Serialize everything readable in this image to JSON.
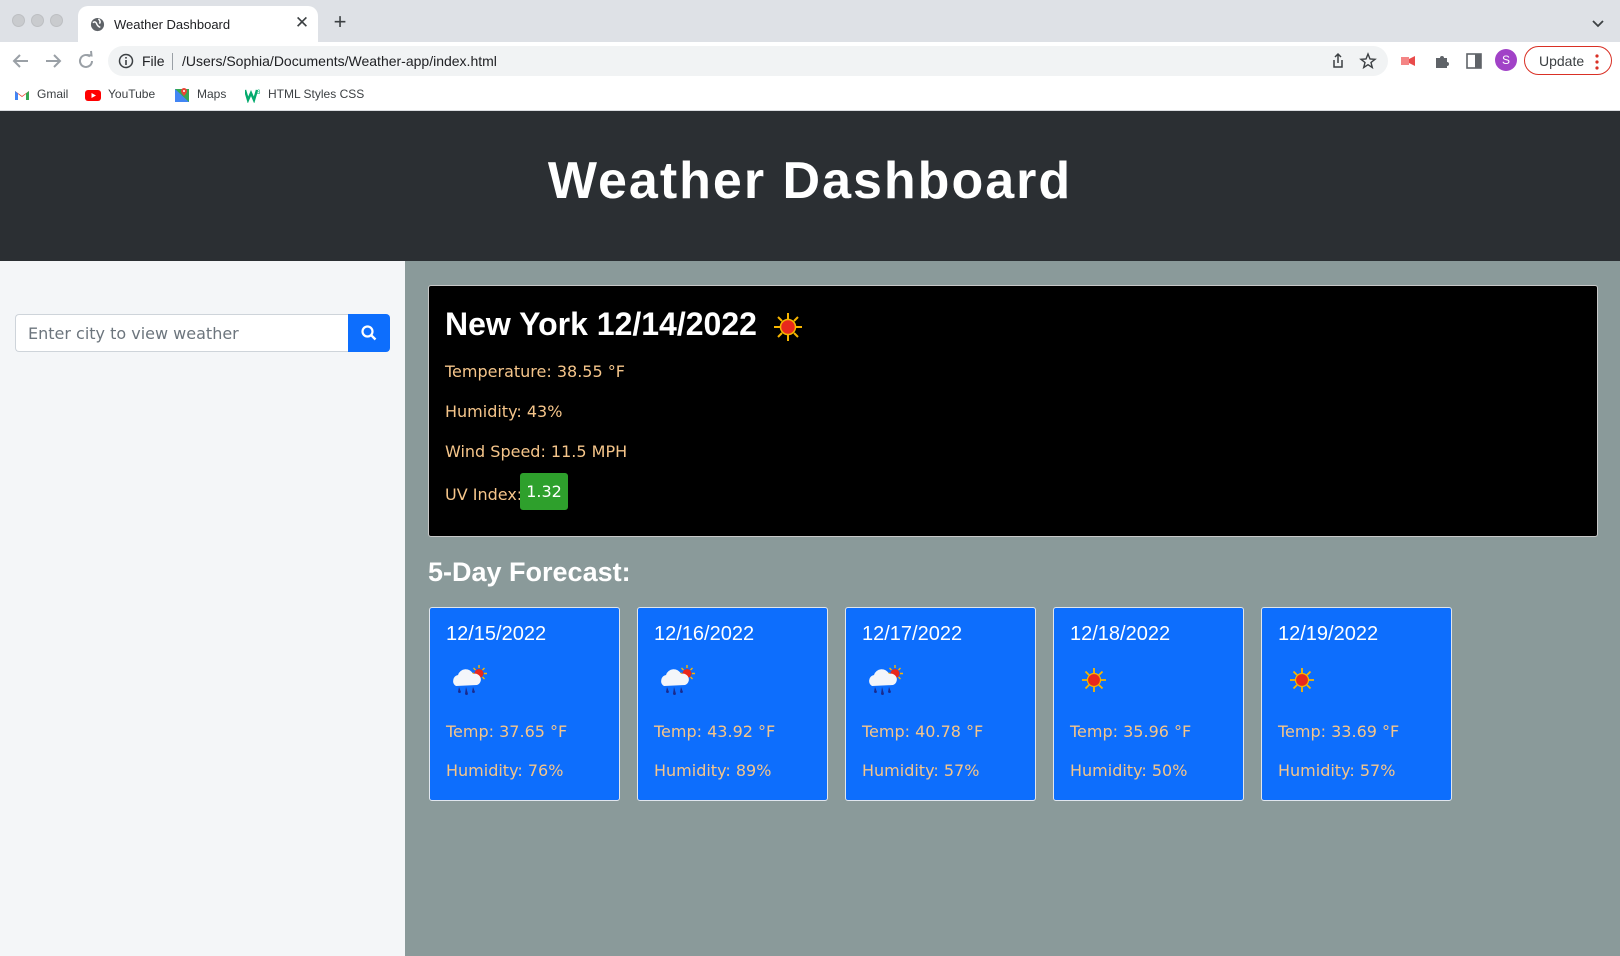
{
  "browser": {
    "tab_title": "Weather Dashboard",
    "omnibox_scheme": "File",
    "url": "/Users/Sophia/Documents/Weather-app/index.html",
    "profile_initial": "S",
    "update_label": "Update",
    "bookmarks": [
      {
        "label": "Gmail",
        "icon": "gmail-icon"
      },
      {
        "label": "YouTube",
        "icon": "youtube-icon"
      },
      {
        "label": "Maps",
        "icon": "maps-icon"
      },
      {
        "label": "HTML Styles CSS",
        "icon": "w3schools-icon"
      }
    ]
  },
  "header": {
    "title": "Weather Dashboard"
  },
  "search": {
    "placeholder": "Enter city to view weather",
    "button_icon": "search-icon"
  },
  "current": {
    "title": "New York 12/14/2022",
    "icon": "sun-icon",
    "temperature": "Temperature: 38.55 °F",
    "humidity": "Humidity: 43%",
    "wind": "Wind Speed: 11.5 MPH",
    "uv_label": "UV Index:",
    "uv_value": "1.32"
  },
  "forecast": {
    "title": "5-Day Forecast:",
    "days": [
      {
        "date": "12/15/2022",
        "icon": "rain-cloud-sun-icon",
        "temp": "Temp: 37.65 °F",
        "humidity": "Humidity: 76%"
      },
      {
        "date": "12/16/2022",
        "icon": "rain-cloud-sun-icon",
        "temp": "Temp: 43.92 °F",
        "humidity": "Humidity: 89%"
      },
      {
        "date": "12/17/2022",
        "icon": "rain-cloud-sun-icon",
        "temp": "Temp: 40.78 °F",
        "humidity": "Humidity: 57%"
      },
      {
        "date": "12/18/2022",
        "icon": "sun-icon",
        "temp": "Temp: 35.96 °F",
        "humidity": "Humidity: 50%"
      },
      {
        "date": "12/19/2022",
        "icon": "sun-icon",
        "temp": "Temp: 33.69 °F",
        "humidity": "Humidity: 57%"
      }
    ]
  },
  "colors": {
    "header_bg": "#2b2f33",
    "main_bg": "#8a9a9a",
    "card_blue": "#0d6efd",
    "stat_text": "#f5c58a",
    "uv_good": "#2ea02c"
  }
}
